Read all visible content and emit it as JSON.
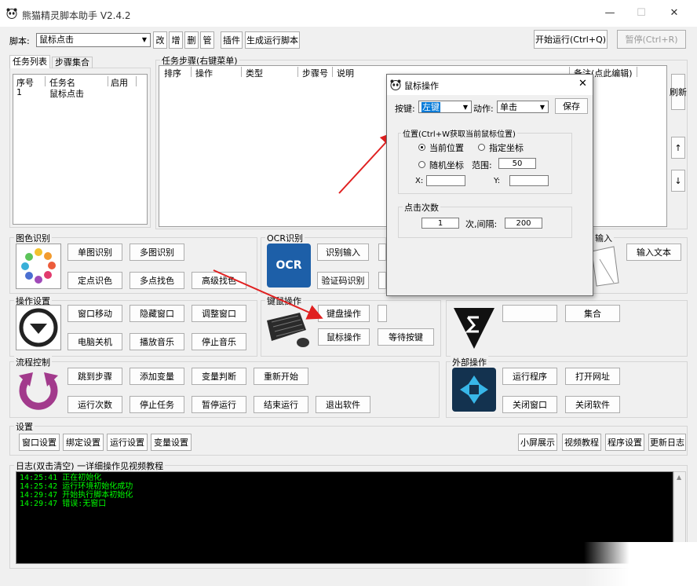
{
  "window": {
    "title": "熊猫精灵脚本助手  V2.4.2"
  },
  "toolbar": {
    "script_label": "脚本:",
    "script_value": "鼠标点击",
    "btn_change": "改",
    "btn_add": "增",
    "btn_delete": "删",
    "btn_manage": "管",
    "btn_plugin": "插件",
    "btn_generate": "生成运行脚本",
    "btn_start": "开始运行(Ctrl+Q)",
    "btn_pause": "暂停(Ctrl+R)"
  },
  "left_tabs": [
    "任务列表",
    "步骤集合"
  ],
  "task_table": {
    "headers": [
      "序号",
      "任务名",
      "启用"
    ],
    "rows": [
      {
        "index": "1",
        "name": "鼠标点击",
        "enabled": ""
      }
    ]
  },
  "steps": {
    "group_label": "任务步骤(右键菜单)",
    "headers": [
      "排序",
      "操作",
      "类型",
      "步骤号",
      "说明",
      "备注(点此编辑)"
    ]
  },
  "side_buttons": {
    "refresh": "刷新",
    "up": "↑",
    "down": "↓"
  },
  "color_group": {
    "label": "图色识别",
    "buttons": [
      "单图识别",
      "多图识别",
      "定点识色",
      "多点找色",
      "高级找色"
    ]
  },
  "ocr_group": {
    "label": "OCR识别",
    "icon_text": "OCR",
    "buttons": [
      "识别输入",
      "验证码识别"
    ]
  },
  "input_group": {
    "label": "输入",
    "buttons": [
      "输入文本"
    ]
  },
  "ops_group": {
    "label": "操作设置",
    "buttons": [
      "窗口移动",
      "隐藏窗口",
      "调整窗口",
      "电脑关机",
      "播放音乐",
      "停止音乐"
    ]
  },
  "kbd_group": {
    "label": "键鼠操作",
    "buttons": [
      "键盘操作",
      "鼠标操作",
      "等待按键"
    ]
  },
  "collect_group": {
    "buttons": [
      "集合"
    ]
  },
  "flow_group": {
    "label": "流程控制",
    "buttons": [
      "跳到步骤",
      "添加变量",
      "变量判断",
      "重新开始",
      "运行次数",
      "停止任务",
      "暂停运行",
      "结束运行",
      "退出软件"
    ]
  },
  "ext_group": {
    "label": "外部操作",
    "buttons": [
      "运行程序",
      "打开网址",
      "关闭窗口",
      "关闭软件"
    ]
  },
  "settings": {
    "label": "设置",
    "left_buttons": [
      "窗口设置",
      "绑定设置",
      "运行设置",
      "变量设置"
    ],
    "right_buttons": [
      "小屏展示",
      "视频教程",
      "程序设置",
      "更新日志"
    ]
  },
  "log": {
    "label": "日志(双击清空)   一详细操作见视频教程",
    "lines": [
      {
        "time": "14:25:41",
        "text": "正在初始化"
      },
      {
        "time": "14:25:42",
        "text": "运行环境初始化成功"
      },
      {
        "time": "14:29:47",
        "text": "开始执行脚本初始化"
      },
      {
        "time": "14:29:47",
        "text": "错误:无窗口"
      }
    ]
  },
  "dialog": {
    "title": "鼠标操作",
    "key_label": "按键:",
    "key_value": "左键",
    "action_label": "动作:",
    "action_value": "单击",
    "save": "保存",
    "position_label": "位置(Ctrl+W获取当前鼠标位置)",
    "radio_current": "当前位置",
    "radio_specified": "指定坐标",
    "radio_random": "随机坐标",
    "range_label": "范围:",
    "range_value": "50",
    "x_label": "X:",
    "x_value": "",
    "y_label": "Y:",
    "y_value": "",
    "clicks_label": "点击次数",
    "clicks_value": "1",
    "interval_label": "次,间隔:",
    "interval_value": "200"
  },
  "colors": {
    "annotation_arrow": "#e02020",
    "log_text": "#00ff00",
    "selection": "#0078d7"
  }
}
